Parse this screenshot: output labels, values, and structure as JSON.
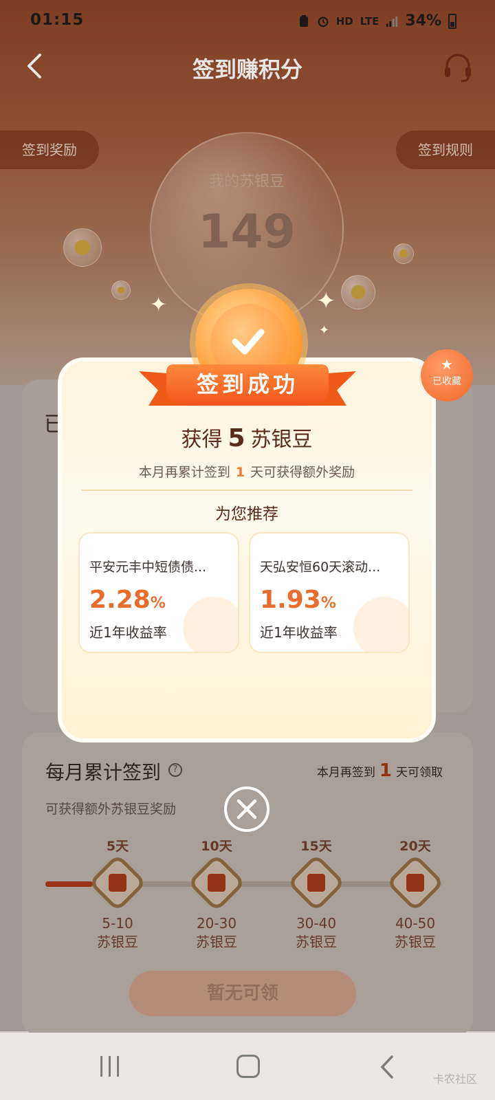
{
  "status_bar": {
    "time": "01:15",
    "network_hd": "HD",
    "network_lte": "LTE",
    "battery": "34%"
  },
  "header": {
    "title": "签到赚积分",
    "back_icon": "chevron-left-icon",
    "service_icon": "headset-icon"
  },
  "tabs": {
    "left": "签到奖励",
    "right": "签到规则"
  },
  "balance": {
    "label": "我的苏银豆",
    "value": "149"
  },
  "bg_card_stub": "已",
  "modal": {
    "badge": "签到成功",
    "earned_prefix": "获得",
    "earned_amount": "5",
    "earned_suffix": "苏银豆",
    "extra_prefix": "本月再累计签到",
    "extra_days": "1",
    "extra_suffix": "天可获得额外奖励",
    "recommend_title": "为您推荐",
    "funds": [
      {
        "name": "平安元丰中短债债...",
        "rate": "2.28",
        "unit": "%",
        "label": "近1年收益率"
      },
      {
        "name": "天弘安恒60天滚动...",
        "rate": "1.93",
        "unit": "%",
        "label": "近1年收益率"
      }
    ],
    "collected_label": "已收藏"
  },
  "monthly": {
    "title": "每月累计签到",
    "hint_prefix": "本月再签到",
    "hint_days": "1",
    "hint_suffix": "天可领取",
    "subtitle": "可获得额外苏银豆奖励",
    "progress_fraction": 0.12,
    "milestones": [
      {
        "day": "5天",
        "reward": "5-10",
        "unit": "苏银豆"
      },
      {
        "day": "10天",
        "reward": "20-30",
        "unit": "苏银豆"
      },
      {
        "day": "15天",
        "reward": "30-40",
        "unit": "苏银豆"
      },
      {
        "day": "20天",
        "reward": "40-50",
        "unit": "苏银豆"
      }
    ],
    "claim_button": "暂无可领"
  },
  "watermark": "卡农社区",
  "colors": {
    "accent": "#f07a2a",
    "ribbon": "#f0541a",
    "rate": "#e86d2c",
    "header_bg": "#8a4427"
  }
}
